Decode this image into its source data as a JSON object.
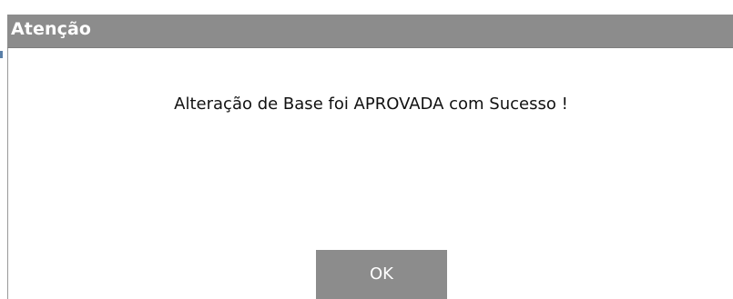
{
  "dialog": {
    "title": "Atenção",
    "message": "Alteração de Base foi APROVADA com Sucesso !",
    "ok_label": "OK"
  },
  "colors": {
    "titlebar": "#8c8c8c",
    "button": "#8c8c8c",
    "title_text": "#ffffff",
    "message_text": "#111111"
  }
}
